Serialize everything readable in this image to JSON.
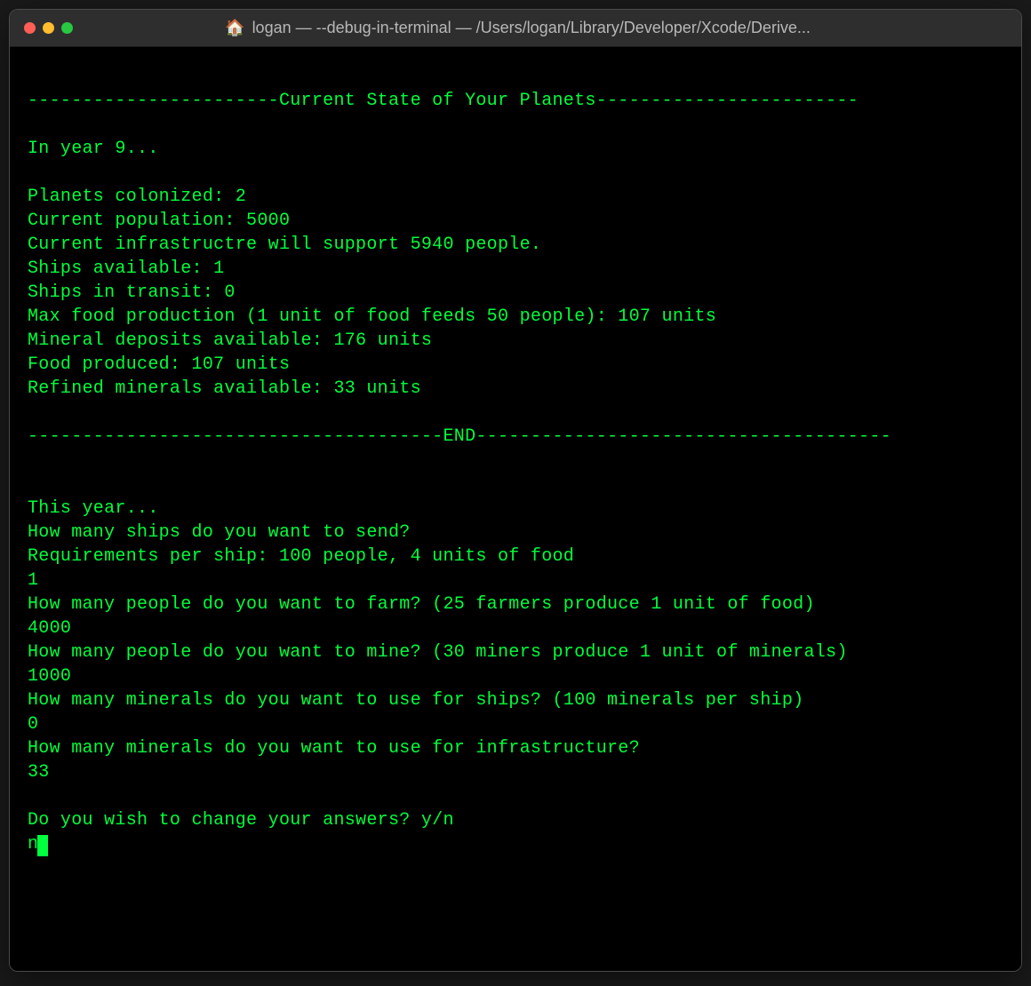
{
  "window": {
    "title": "logan — --debug-in-terminal — /Users/logan/Library/Developer/Xcode/Derive..."
  },
  "terminal": {
    "blank_top": " ",
    "header_line": "-----------------------Current State of Your Planets------------------------",
    "blank1": "",
    "year_line": "In year 9...",
    "blank2": "",
    "planets_line": "Planets colonized: 2",
    "population_line": "Current population: 5000",
    "infrastructure_line": "Current infrastructre will support 5940 people.",
    "ships_avail_line": "Ships available: 1",
    "ships_transit_line": "Ships in transit: 0",
    "food_prod_line": "Max food production (1 unit of food feeds 50 people): 107 units",
    "mineral_deposits_line": "Mineral deposits available: 176 units",
    "food_produced_line": "Food produced: 107 units",
    "refined_minerals_line": "Refined minerals available: 33 units",
    "blank3": "",
    "end_line": "--------------------------------------END--------------------------------------",
    "blank4": "",
    "blank5": "",
    "this_year_line": "This year...",
    "q_ships_line": "How many ships do you want to send?",
    "req_line": "Requirements per ship: 100 people, 4 units of food",
    "a_ships": "1",
    "q_farm_line": "How many people do you want to farm? (25 farmers produce 1 unit of food)",
    "a_farm": "4000",
    "q_mine_line": "How many people do you want to mine? (30 miners produce 1 unit of minerals)",
    "a_mine": "1000",
    "q_mineral_ships_line": "How many minerals do you want to use for ships? (100 minerals per ship)",
    "a_mineral_ships": "0",
    "q_mineral_infra_line": "How many minerals do you want to use for infrastructure?",
    "a_mineral_infra": "33",
    "blank6": "",
    "q_change_line": "Do you wish to change your answers? y/n",
    "a_change": "n"
  }
}
